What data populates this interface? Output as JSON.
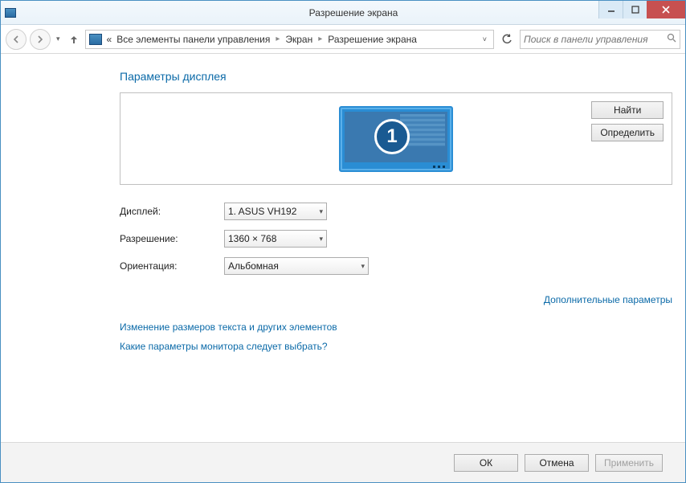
{
  "window": {
    "title": "Разрешение экрана"
  },
  "breadcrumb": {
    "prefix": "«",
    "items": [
      "Все элементы панели управления",
      "Экран",
      "Разрешение экрана"
    ]
  },
  "search": {
    "placeholder": "Поиск в панели управления"
  },
  "page": {
    "heading": "Параметры дисплея",
    "monitor_number": "1",
    "find_btn": "Найти",
    "identify_btn": "Определить",
    "form": {
      "display_label": "Дисплей:",
      "display_value": "1. ASUS VH192",
      "resolution_label": "Разрешение:",
      "resolution_value": "1360 × 768",
      "orientation_label": "Ориентация:",
      "orientation_value": "Альбомная"
    },
    "advanced_link": "Дополнительные параметры",
    "links": {
      "resize_text": "Изменение размеров текста и других элементов",
      "which_monitor": "Какие параметры монитора следует выбрать?"
    }
  },
  "footer": {
    "ok": "ОК",
    "cancel": "Отмена",
    "apply": "Применить"
  }
}
